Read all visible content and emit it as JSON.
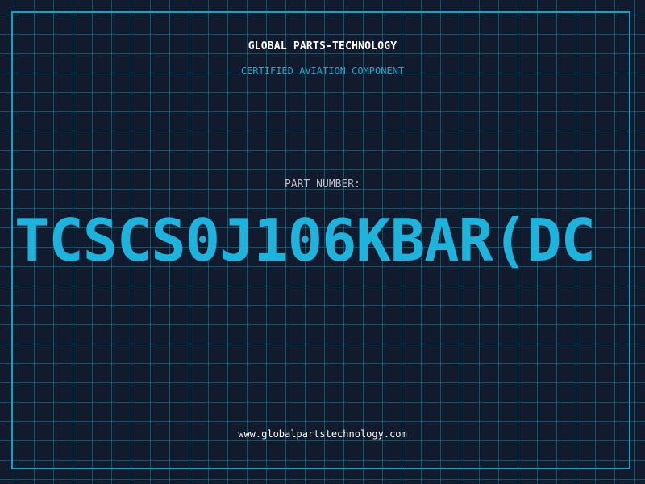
{
  "header": {
    "brand": "GLOBAL PARTS-TECHNOLOGY",
    "subtitle": "CERTIFIED AVIATION COMPONENT"
  },
  "part": {
    "label": "PART NUMBER:",
    "number": "TCSCS0J106KBAR(DC"
  },
  "footer": {
    "website": "www.globalpartstechnology.com"
  },
  "colors": {
    "background": "#121a2e",
    "grid": "#28788c",
    "accent": "#1cb4dc",
    "frame": "#1a9fc0"
  }
}
